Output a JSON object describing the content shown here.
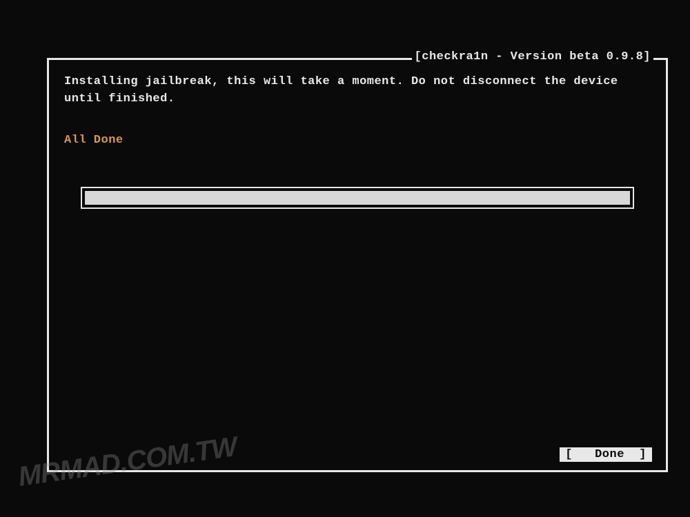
{
  "box": {
    "title": "[checkra1n - Version beta 0.9.8]"
  },
  "content": {
    "message": "Installing jailbreak, this will take a moment. Do not disconnect the device until finished.",
    "status": "All Done"
  },
  "progress": {
    "percent": 100
  },
  "actions": {
    "done_label": "[   Done  ]"
  },
  "watermark": "MRMAD.COM.TW"
}
